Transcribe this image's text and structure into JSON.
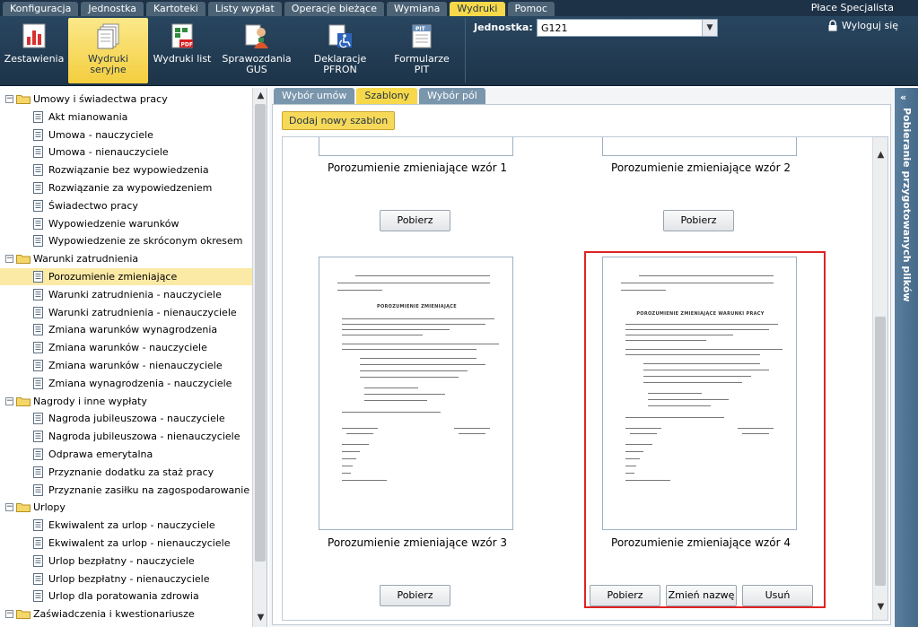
{
  "app": {
    "title": "Płace Specjalista"
  },
  "menu": [
    {
      "label": "Konfiguracja",
      "active": false
    },
    {
      "label": "Jednostka",
      "active": false
    },
    {
      "label": "Kartoteki",
      "active": false
    },
    {
      "label": "Listy wypłat",
      "active": false
    },
    {
      "label": "Operacje bieżące",
      "active": false
    },
    {
      "label": "Wymiana",
      "active": false
    },
    {
      "label": "Wydruki",
      "active": true
    },
    {
      "label": "Pomoc",
      "active": false
    }
  ],
  "ribbon": {
    "buttons": [
      {
        "line1": "Zestawienia",
        "line2": "",
        "icon": "bar-chart-icon",
        "active": false
      },
      {
        "line1": "Wydruki",
        "line2": "seryjne",
        "icon": "document-stack-icon",
        "active": true
      },
      {
        "line1": "Wydruki list",
        "line2": "",
        "icon": "pdf-list-icon",
        "active": false
      },
      {
        "line1": "Sprawozdania",
        "line2": "GUS",
        "icon": "gus-report-icon",
        "active": false
      },
      {
        "line1": "Deklaracje",
        "line2": "PFRON",
        "icon": "pfron-declaration-icon",
        "active": false
      },
      {
        "line1": "Formularze PIT",
        "line2": "",
        "icon": "pit-form-icon",
        "active": false
      }
    ],
    "unit_label": "Jednostka:",
    "unit_value": "G121",
    "logout": "Wyloguj się"
  },
  "tree": [
    {
      "type": "folder",
      "label": "Umowy i świadectwa pracy",
      "children": [
        "Akt mianowania",
        "Umowa - nauczyciele",
        "Umowa - nienauczyciele",
        "Rozwiązanie bez wypowiedzenia",
        "Rozwiązanie za wypowiedzeniem",
        "Świadectwo pracy",
        "Wypowiedzenie warunków",
        "Wypowiedzenie ze skróconym okresem"
      ]
    },
    {
      "type": "folder",
      "label": "Warunki zatrudnienia",
      "children": [
        "Porozumienie zmieniające",
        "Warunki zatrudnienia - nauczyciele",
        "Warunki zatrudnienia - nienauczyciele",
        "Zmiana warunków wynagrodzenia",
        "Zmiana warunków - nauczyciele",
        "Zmiana warunków - nienauczyciele",
        "Zmiana wynagrodzenia - nauczyciele"
      ]
    },
    {
      "type": "folder",
      "label": "Nagrody i inne wypłaty",
      "children": [
        "Nagroda jubileuszowa - nauczyciele",
        "Nagroda jubileuszowa - nienauczyciele",
        "Odprawa emerytalna",
        "Przyznanie dodatku za staż pracy",
        "Przyznanie zasiłku na zagospodarowanie"
      ]
    },
    {
      "type": "folder",
      "label": "Urlopy",
      "children": [
        "Ekwiwalent za urlop - nauczyciele",
        "Ekwiwalent za urlop - nienauczyciele",
        "Urlop bezpłatny - nauczyciele",
        "Urlop bezpłatny - nienauczyciele",
        "Urlop dla poratowania zdrowia"
      ]
    },
    {
      "type": "folder",
      "label": "Zaświadczenia i kwestionariusze",
      "children": []
    }
  ],
  "tree_selected": "Porozumienie zmieniające",
  "tabs": [
    {
      "label": "Wybór umów",
      "active": false
    },
    {
      "label": "Szablony",
      "active": true
    },
    {
      "label": "Wybór pól",
      "active": false
    }
  ],
  "add_template": "Dodaj nowy szablon",
  "templates": [
    {
      "title": "Porozumienie zmieniające wzór 1",
      "actions": [
        "Pobierz"
      ]
    },
    {
      "title": "Porozumienie zmieniające wzór 2",
      "actions": [
        "Pobierz"
      ]
    },
    {
      "title": "Porozumienie zmieniające wzór 3",
      "actions": [
        "Pobierz"
      ],
      "doc_heading": "POROZUMIENIE ZMIENIAJĄCE"
    },
    {
      "title": "Porozumienie zmieniające wzór 4",
      "actions": [
        "Pobierz",
        "Zmień nazwę",
        "Usuń"
      ],
      "doc_heading": "POROZUMIENIE ZMIENIAJĄCE WARUNKI PRACY",
      "selected": true
    }
  ],
  "right_panel": {
    "label": "Pobieranie przygotowanych plików",
    "toggle": "«"
  },
  "colors": {
    "dark": "#1d3247",
    "accent": "#f6d84a",
    "selection": "#fbe9a6",
    "highlight_border": "#e02323"
  }
}
